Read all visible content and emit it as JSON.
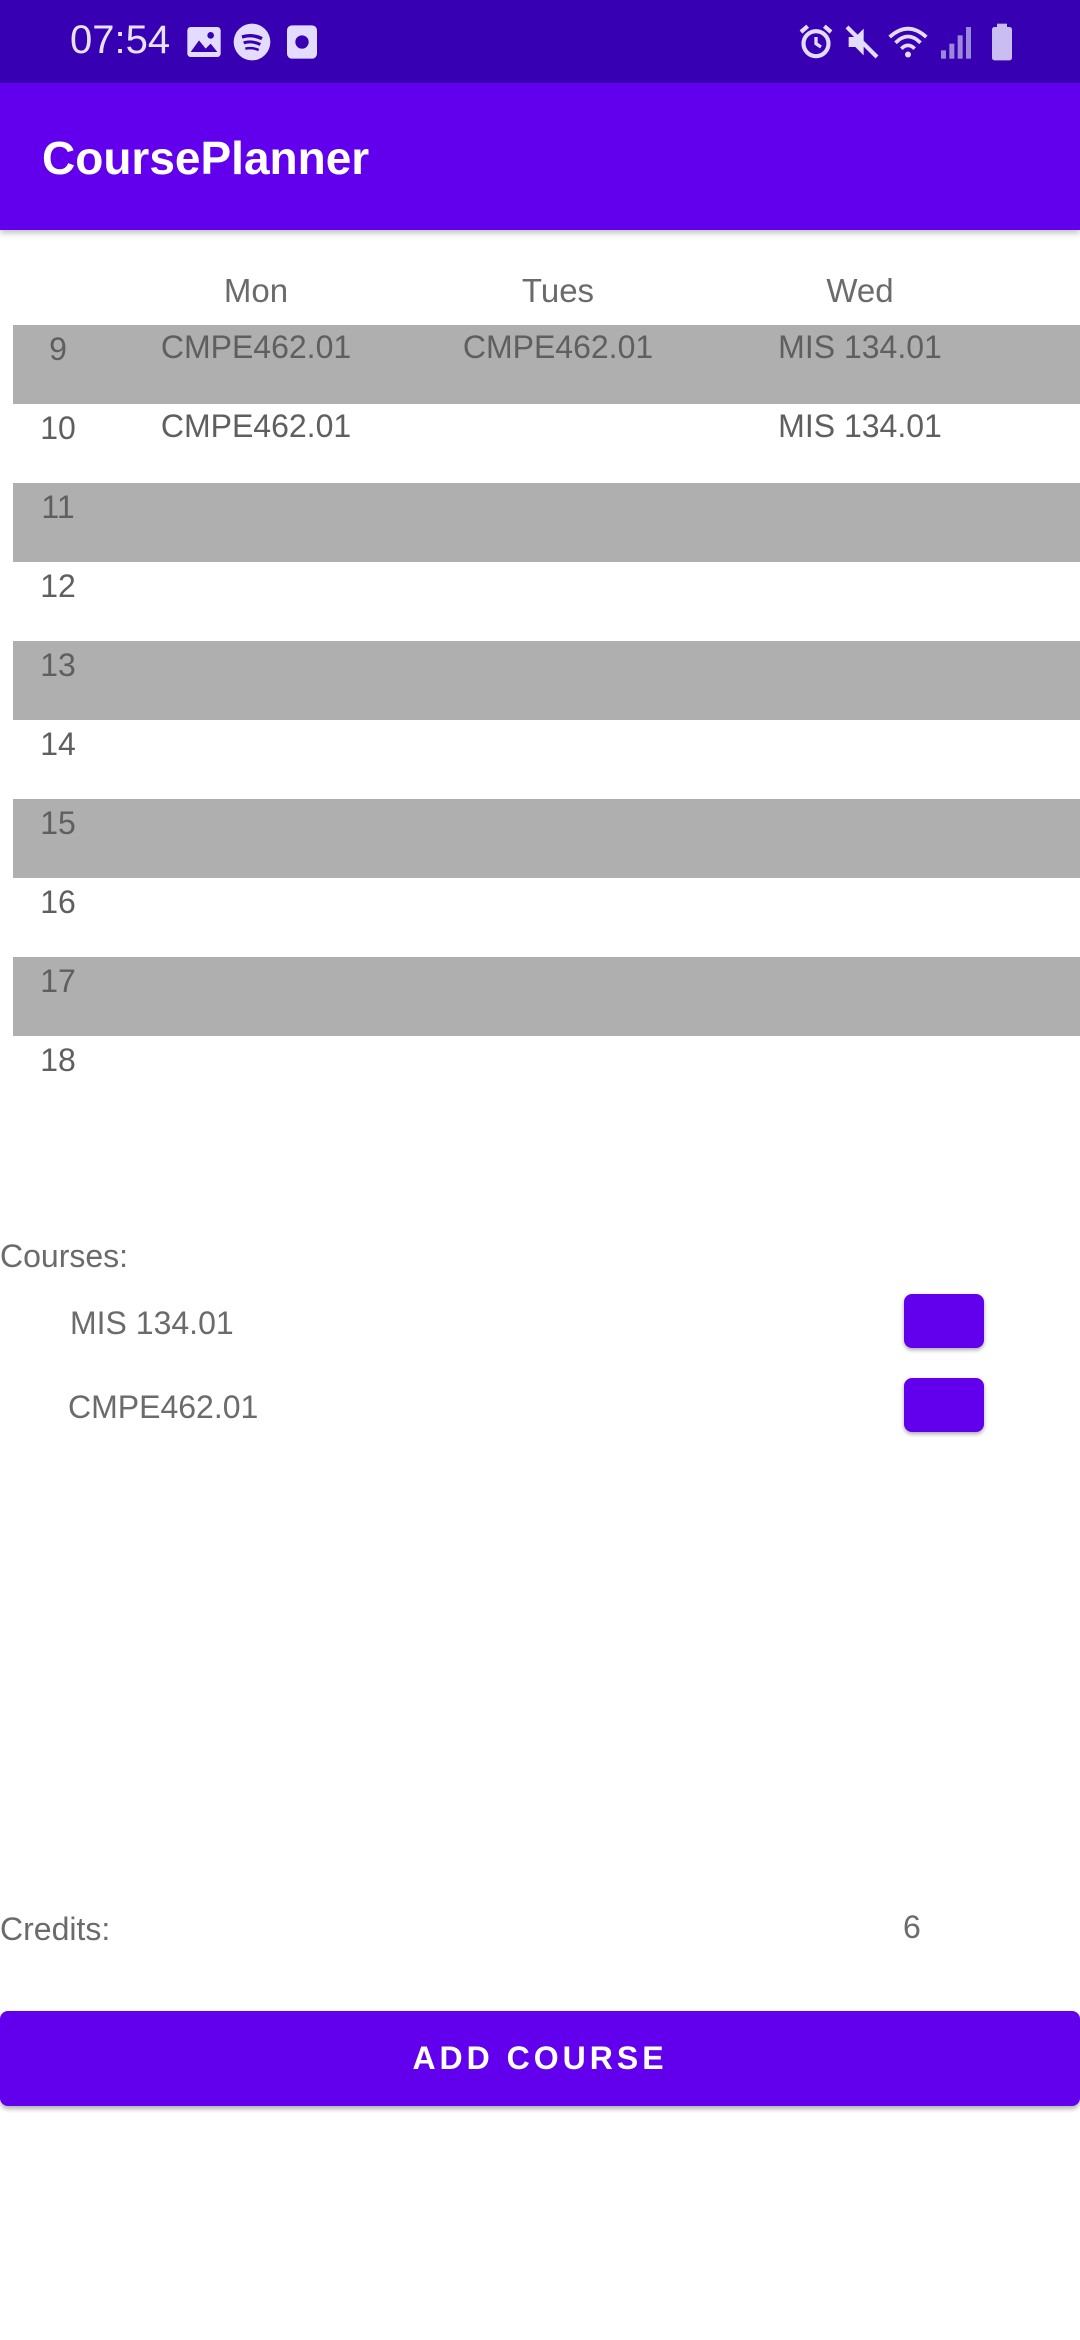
{
  "status_bar": {
    "time": "07:54",
    "left_icons": [
      "gallery-icon",
      "spotify-icon",
      "screen-record-icon"
    ],
    "right_icons": [
      "alarm-icon",
      "mute-icon",
      "wifi-icon",
      "signal-icon",
      "battery-icon"
    ]
  },
  "app_bar": {
    "title": "CoursePlanner"
  },
  "schedule": {
    "days": [
      "Mon",
      "Tues",
      "Wed"
    ],
    "rows": [
      {
        "hour": "9",
        "cells": [
          "CMPE462.01",
          "CMPE462.01",
          "MIS 134.01"
        ]
      },
      {
        "hour": "10",
        "cells": [
          "CMPE462.01",
          "",
          "MIS 134.01"
        ]
      },
      {
        "hour": "11",
        "cells": [
          "",
          "",
          ""
        ]
      },
      {
        "hour": "12",
        "cells": [
          "",
          "",
          ""
        ]
      },
      {
        "hour": "13",
        "cells": [
          "",
          "",
          ""
        ]
      },
      {
        "hour": "14",
        "cells": [
          "",
          "",
          ""
        ]
      },
      {
        "hour": "15",
        "cells": [
          "",
          "",
          ""
        ]
      },
      {
        "hour": "16",
        "cells": [
          "",
          "",
          ""
        ]
      },
      {
        "hour": "17",
        "cells": [
          "",
          "",
          ""
        ]
      },
      {
        "hour": "18",
        "cells": [
          "",
          "",
          ""
        ]
      }
    ]
  },
  "courses": {
    "label": "Courses:",
    "items": [
      {
        "name": "MIS 134.01"
      },
      {
        "name": "CMPE462.01"
      }
    ]
  },
  "credits": {
    "label": "Credits:",
    "value": "6"
  },
  "add_course": {
    "label": "ADD COURSE"
  },
  "colors": {
    "primary": "#6200ee",
    "primary_dark": "#3700b3",
    "row_shade": "#b0afaf"
  }
}
